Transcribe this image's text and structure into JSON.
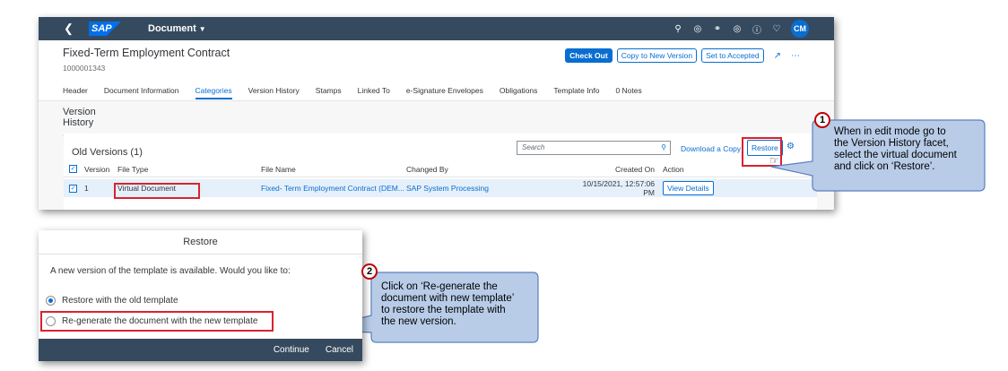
{
  "shell": {
    "back_icon": "chevron-left-icon",
    "logo": "SAP",
    "app_title": "Document",
    "user_initials": "CM",
    "icons": [
      "search-icon",
      "copilot-icon",
      "headset-icon",
      "joule-icon",
      "help-icon",
      "bell-icon"
    ]
  },
  "object": {
    "title": "Fixed-Term Employment Contract",
    "id": "1000001343",
    "actions": {
      "check_out": "Check Out",
      "copy_new_version": "Copy to New Version",
      "set_accepted": "Set to Accepted"
    }
  },
  "tabs": [
    {
      "label": "Header"
    },
    {
      "label": "Document Information"
    },
    {
      "label": "Categories"
    },
    {
      "label": "Version History"
    },
    {
      "label": "Stamps"
    },
    {
      "label": "Linked To"
    },
    {
      "label": "e-Signature Envelopes"
    },
    {
      "label": "Obligations"
    },
    {
      "label": "Template Info"
    },
    {
      "label": "0 Notes"
    }
  ],
  "active_tab": "Categories",
  "section": {
    "title": "Version History",
    "table_title": "Old Versions (1)",
    "search_placeholder": "Search",
    "download_link": "Download a Copy",
    "restore_button": "Restore",
    "columns": {
      "version": "Version",
      "file_type": "File Type",
      "file_name": "File Name",
      "changed_by": "Changed By",
      "created_on": "Created On",
      "action": "Action"
    },
    "rows": [
      {
        "version": "1",
        "file_type": "Virtual Document",
        "file_name": "Fixed- Term Employment Contract (DEM...",
        "changed_by": "SAP System Processing",
        "created_on": "10/15/2021, 12:57:06 PM",
        "action": "View Details"
      }
    ]
  },
  "callouts": {
    "one": {
      "number": "1",
      "text_lines": [
        "When in edit mode go to",
        "the Version History facet,",
        "select the virtual document",
        "and click on ‘Restore’."
      ]
    },
    "two": {
      "number": "2",
      "text_lines": [
        "Click on ‘Re-generate the",
        "document with new template’",
        "to restore the template with",
        "the new version."
      ]
    }
  },
  "dialog": {
    "title": "Restore",
    "message": "A new version of the template is available. Would you like to:",
    "options": [
      {
        "label": "Restore with the old template",
        "selected": true
      },
      {
        "label": "Re-generate the document with the new template",
        "selected": false
      }
    ],
    "continue": "Continue",
    "cancel": "Cancel"
  },
  "colors": {
    "shell": "#354a5f",
    "accent": "#0a6ed1",
    "highlight_box": "#d9232f",
    "callout_fill": "#b4c7e7",
    "callout_border": "#5b7fbf"
  }
}
